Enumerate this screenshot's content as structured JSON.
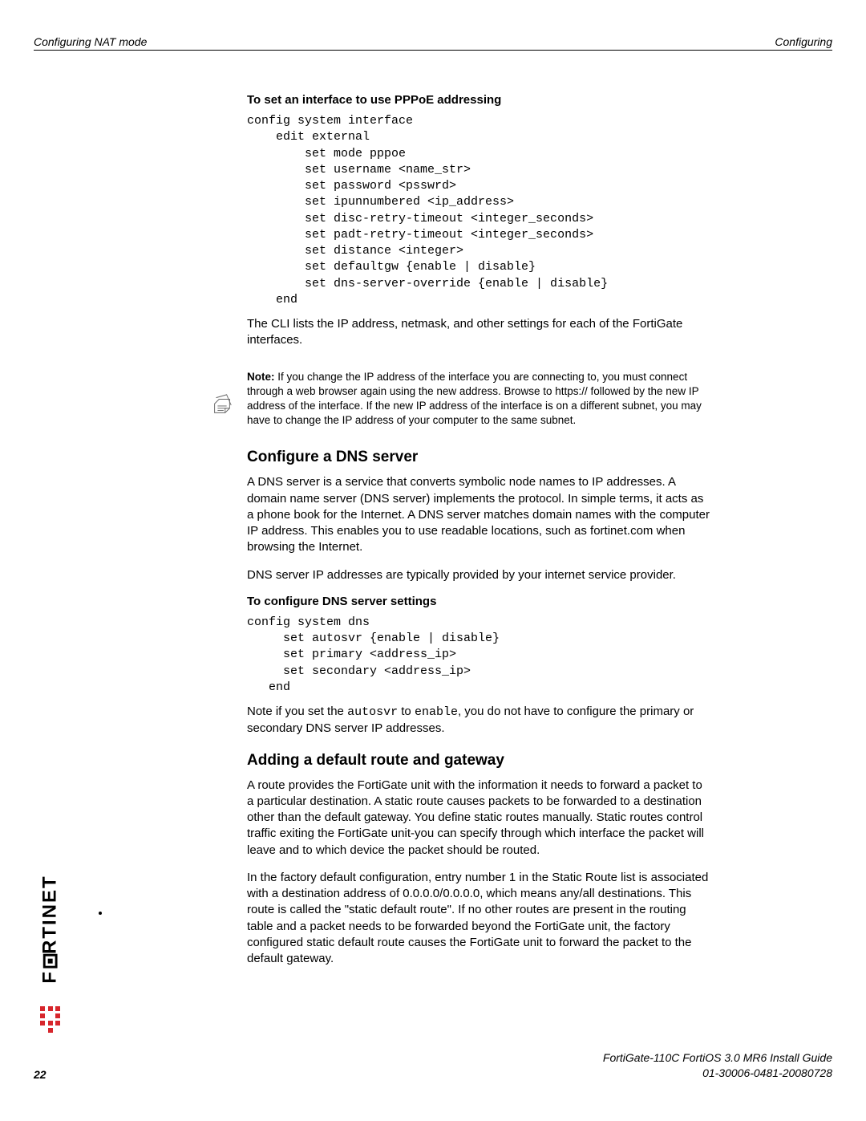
{
  "header": {
    "left": "Configuring NAT mode",
    "right": "Configuring"
  },
  "section1": {
    "title": "To set an interface to use PPPoE addressing",
    "code": "config system interface\n    edit external\n        set mode pppoe\n        set username <name_str>\n        set password <psswrd>\n        set ipunnumbered <ip_address>\n        set disc-retry-timeout <integer_seconds>\n        set padt-retry-timeout <integer_seconds>\n        set distance <integer>\n        set defaultgw {enable | disable}\n        set dns-server-override {enable | disable}\n    end",
    "para": "The CLI lists the IP address, netmask, and other settings for each of the FortiGate interfaces."
  },
  "note": {
    "label": "Note:",
    "text": " If you change the IP address of the interface you are connecting to, you must connect through a web browser again using the new address. Browse to https:// followed by the new IP address of the interface. If the new IP address of the interface is on a different subnet, you may have to change the IP address of your computer to the same subnet."
  },
  "section2": {
    "heading": "Configure a DNS server",
    "para1": "A DNS server is a service that converts symbolic node names to IP addresses. A domain name server (DNS server) implements the protocol. In simple terms, it acts as a phone book for the Internet. A DNS server matches domain names with the computer IP address. This enables you to use readable locations, such as fortinet.com when browsing the Internet.",
    "para2": "DNS server IP addresses are typically provided by your internet service provider.",
    "subtitle": "To configure DNS server settings",
    "code": "config system dns\n     set autosvr {enable | disable}\n     set primary <address_ip>\n     set secondary <address_ip>\n   end",
    "para3_a": "Note if you set the ",
    "para3_mono1": "autosvr",
    "para3_b": " to ",
    "para3_mono2": "enable",
    "para3_c": ", you do not have to configure the primary or secondary DNS server IP addresses."
  },
  "section3": {
    "heading": "Adding a default route and gateway",
    "para1": "A route provides the FortiGate unit with the information it needs to forward a packet to a particular destination. A static route causes packets to be forwarded to a destination other than the default gateway. You define static routes manually. Static routes control traffic exiting the FortiGate unit-you can specify through which interface the packet will leave and to which device the packet should be routed.",
    "para2": "In the factory default configuration, entry number 1 in the Static Route list is associated with a destination address of 0.0.0.0/0.0.0.0, which means any/all destinations. This route is called the \"static default route\". If no other routes are present in the routing table and a packet needs to be forwarded beyond the FortiGate unit, the factory configured static default route causes the FortiGate unit to forward the packet to the default gateway."
  },
  "logo": {
    "text": "RTINET"
  },
  "footer": {
    "line1": "FortiGate-110C FortiOS 3.0 MR6 Install Guide",
    "line2": "01-30006-0481-20080728",
    "page": "22"
  }
}
